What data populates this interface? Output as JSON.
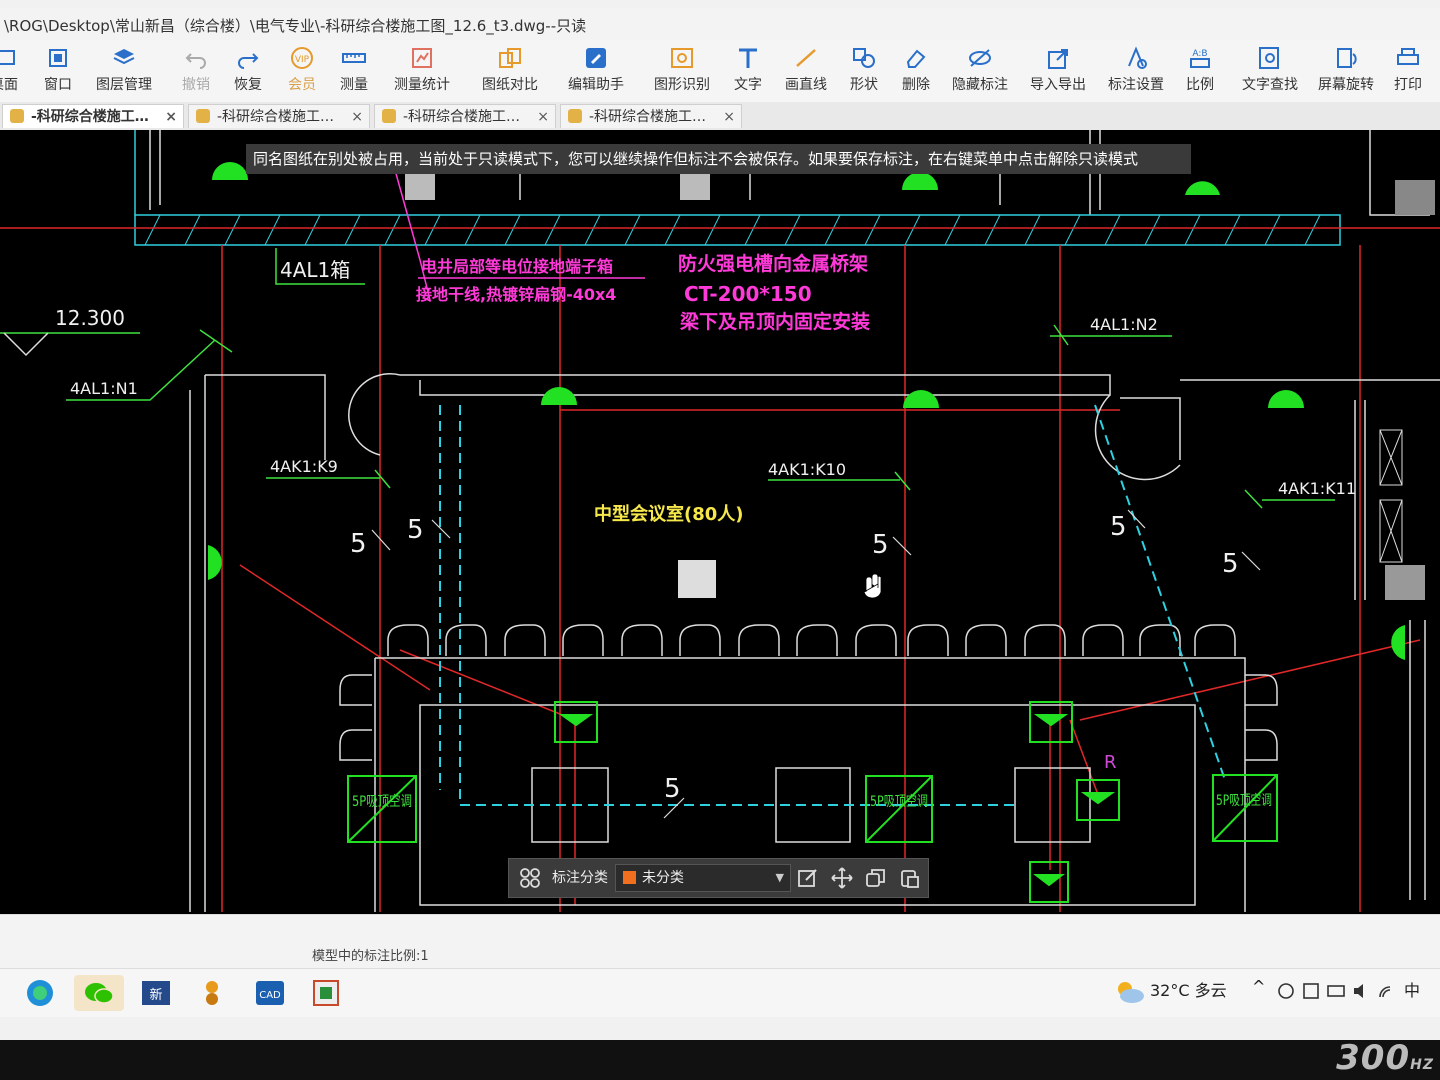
{
  "window": {
    "title": "\\ROG\\Desktop\\常山新昌（综合楼）\\电气专业\\-科研综合楼施工图_12.6_t3.dwg--只读"
  },
  "ribbon": {
    "items": [
      {
        "label": "桌面",
        "icon": "desktop-icon"
      },
      {
        "label": "窗口",
        "icon": "window-icon"
      },
      {
        "label": "图层管理",
        "icon": "layers-icon"
      },
      {
        "label": "撤销",
        "icon": "undo-icon"
      },
      {
        "label": "恢复",
        "icon": "redo-icon"
      },
      {
        "label": "会员",
        "icon": "vip-icon"
      },
      {
        "label": "测量",
        "icon": "ruler-icon"
      },
      {
        "label": "测量统计",
        "icon": "measure-stats-icon"
      },
      {
        "label": "图纸对比",
        "icon": "compare-icon"
      },
      {
        "label": "编辑助手",
        "icon": "edit-helper-icon"
      },
      {
        "label": "图形识别",
        "icon": "shape-recognize-icon"
      },
      {
        "label": "文字",
        "icon": "text-icon"
      },
      {
        "label": "画直线",
        "icon": "line-icon"
      },
      {
        "label": "形状",
        "icon": "shape-icon"
      },
      {
        "label": "删除",
        "icon": "eraser-icon"
      },
      {
        "label": "隐藏标注",
        "icon": "hide-icon"
      },
      {
        "label": "导入导出",
        "icon": "import-export-icon"
      },
      {
        "label": "标注设置",
        "icon": "annotation-settings-icon"
      },
      {
        "label": "比例",
        "icon": "scale-icon"
      },
      {
        "label": "文字查找",
        "icon": "text-search-icon"
      },
      {
        "label": "屏幕旋转",
        "icon": "rotate-screen-icon"
      },
      {
        "label": "打印",
        "icon": "print-icon"
      }
    ]
  },
  "tabs": [
    {
      "label": "-科研综合楼施工…",
      "active": true
    },
    {
      "label": "-科研综合楼施工…",
      "active": false
    },
    {
      "label": "-科研综合楼施工…",
      "active": false
    },
    {
      "label": "-科研综合楼施工…",
      "active": false
    }
  ],
  "notice": "同名图纸在别处被占用，当前处于只读模式下，您可以继续操作但标注不会被保存。如果要保存标注，在右键菜单中点击解除只读模式",
  "drawing": {
    "labels": {
      "box_4al1": "4AL1箱",
      "elevation": "12.300",
      "al1_n1": "4AL1:N1",
      "al1_n2": "4AL1:N2",
      "ak1_k9": "4AK1:K9",
      "ak1_k10": "4AK1:K10",
      "ak1_k11": "4AK1:K11",
      "room": "中型会议室(80人)",
      "magenta_1": "电井局部等电位接地端子箱",
      "magenta_2": "接地干线,热镀锌扁钢-40x4",
      "magenta_3": "防火强电槽向金属桥架",
      "magenta_4": "CT-200*150",
      "magenta_5": "梁下及吊顶内固定安装",
      "five": "5",
      "ac_unit": "5P吸顶空调",
      "r_mark": "R"
    }
  },
  "annotbar": {
    "label": "标注分类",
    "selected": "未分类",
    "swatch_color": "#f07020"
  },
  "statusbar": {
    "scale_text": "模型中的标注比例:1"
  },
  "taskbar": {
    "weather": "32°C 多云",
    "ime": "中",
    "icons": [
      "edge-icon",
      "wechat-icon",
      "app-icon",
      "app2-icon",
      "cad-icon",
      "cad2-icon"
    ]
  },
  "monitor": {
    "refresh": "300",
    "unit": "HZ"
  }
}
